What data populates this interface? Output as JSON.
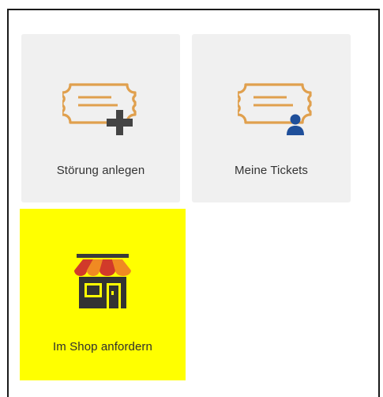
{
  "tiles": [
    {
      "label": "Störung anlegen",
      "icon": "ticket-add-icon"
    },
    {
      "label": "Meine Tickets",
      "icon": "ticket-user-icon"
    },
    {
      "label": "Im Shop anfordern",
      "icon": "shop-icon"
    }
  ],
  "colors": {
    "tile_background": "#f0f0f0",
    "highlight": "#ffff00",
    "ticket_outline": "#e0a04e",
    "plus": "#444444",
    "user_badge": "#1f4f9a",
    "awning_orange": "#f08a22",
    "awning_red": "#d13a2a",
    "shop_body": "#333333"
  }
}
